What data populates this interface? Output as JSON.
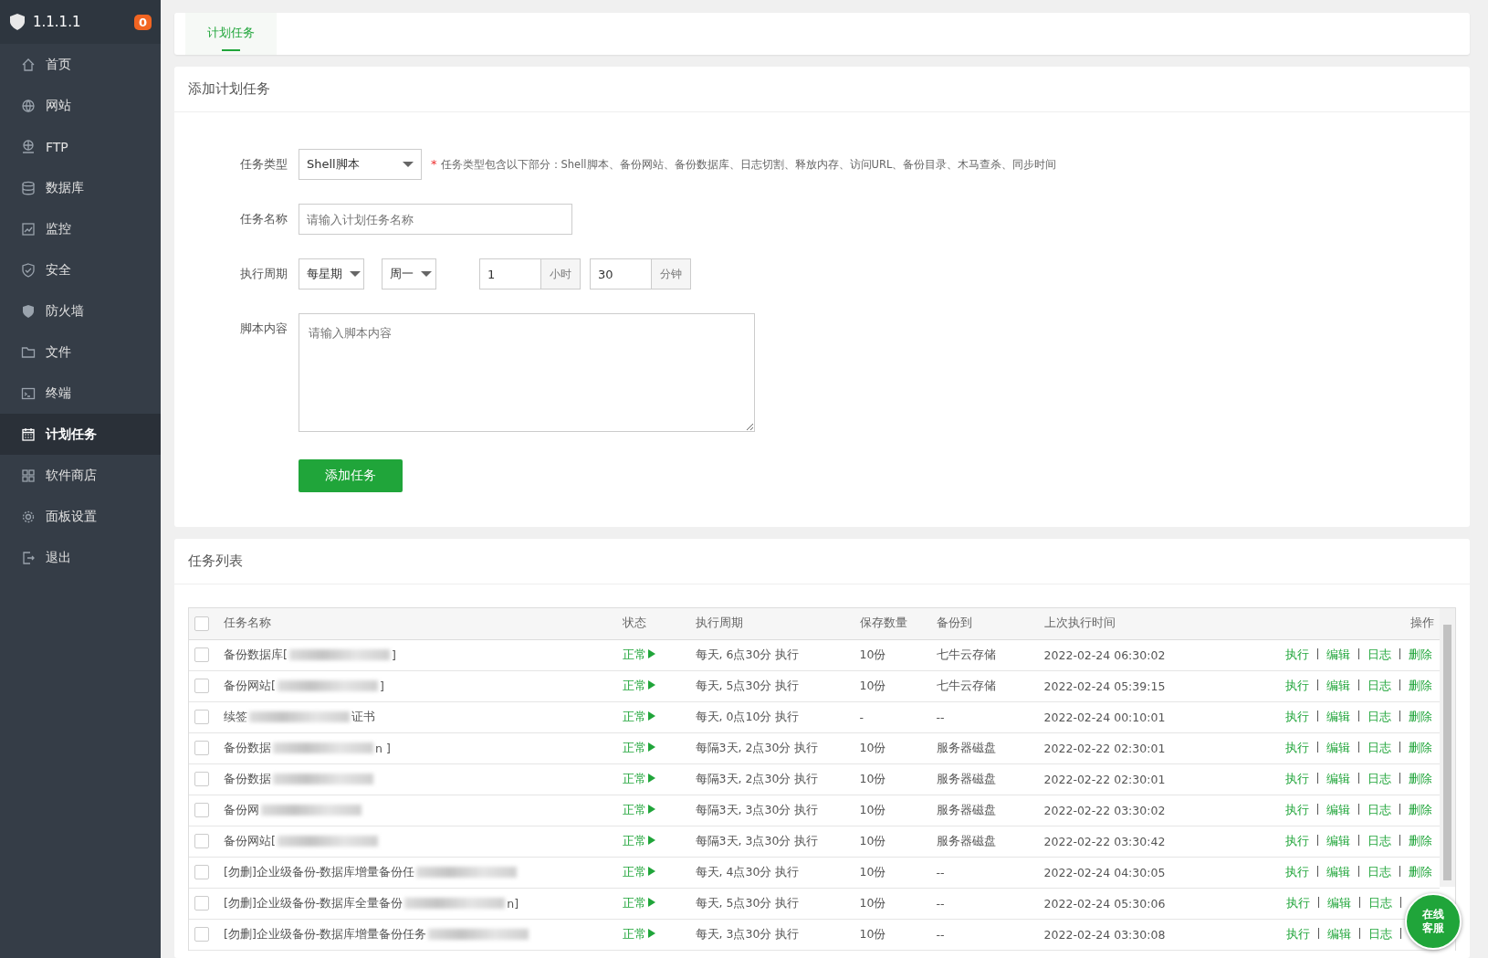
{
  "sidebar": {
    "brand": "1.1.1.1",
    "badge": "0",
    "items": [
      {
        "label": "首页",
        "selected": false
      },
      {
        "label": "网站",
        "selected": false
      },
      {
        "label": "FTP",
        "selected": false
      },
      {
        "label": "数据库",
        "selected": false
      },
      {
        "label": "监控",
        "selected": false
      },
      {
        "label": "安全",
        "selected": false
      },
      {
        "label": "防火墙",
        "selected": false
      },
      {
        "label": "文件",
        "selected": false
      },
      {
        "label": "终端",
        "selected": false
      },
      {
        "label": "计划任务",
        "selected": true
      },
      {
        "label": "软件商店",
        "selected": false
      },
      {
        "label": "面板设置",
        "selected": false
      },
      {
        "label": "退出",
        "selected": false
      }
    ]
  },
  "tabs": [
    {
      "label": "计划任务",
      "selected": true
    }
  ],
  "add_form": {
    "title": "添加计划任务",
    "type_label": "任务类型",
    "type_value": "Shell脚本",
    "required_mark": "*",
    "type_hint": "任务类型包含以下部分：Shell脚本、备份网站、备份数据库、日志切割、释放内存、访问URL、备份目录、木马查杀、同步时间",
    "name_label": "任务名称",
    "name_placeholder": "请输入计划任务名称",
    "cycle_label": "执行周期",
    "cycle_value": "每星期",
    "weekday_value": "周一",
    "hour_value": "1",
    "hour_unit": "小时",
    "minute_value": "30",
    "minute_unit": "分钟",
    "script_label": "脚本内容",
    "script_placeholder": "请输入脚本内容",
    "submit": "添加任务"
  },
  "task_list": {
    "title": "任务列表",
    "select_all_checked": false,
    "columns": [
      "任务名称",
      "状态",
      "执行周期",
      "保存数量",
      "备份到",
      "上次执行时间",
      "操作"
    ],
    "rows": [
      {
        "checked": false,
        "name": [
          "备份数据库[",
          "]"
        ],
        "redacted": true,
        "status": "正常",
        "cycle": "每天, 6点30分 执行",
        "keep": "10份",
        "backup_to": "七牛云存储",
        "last_run": "2022-02-24 06:30:02",
        "actions": [
          "执行",
          "编辑",
          "日志",
          "删除"
        ]
      },
      {
        "checked": false,
        "name": [
          "备份网站[",
          "]"
        ],
        "redacted": true,
        "status": "正常",
        "cycle": "每天, 5点30分 执行",
        "keep": "10份",
        "backup_to": "七牛云存储",
        "last_run": "2022-02-24 05:39:15",
        "actions": [
          "执行",
          "编辑",
          "日志",
          "删除"
        ]
      },
      {
        "checked": false,
        "name": [
          "续签",
          "证书"
        ],
        "redacted": true,
        "status": "正常",
        "cycle": "每天, 0点10分 执行",
        "keep": "-",
        "backup_to": "--",
        "last_run": "2022-02-24 00:10:01",
        "actions": [
          "执行",
          "编辑",
          "日志",
          "删除"
        ]
      },
      {
        "checked": false,
        "name": [
          "备份数据",
          "n ]"
        ],
        "redacted": true,
        "status": "正常",
        "cycle": "每隔3天, 2点30分 执行",
        "keep": "10份",
        "backup_to": "服务器磁盘",
        "last_run": "2022-02-22 02:30:01",
        "actions": [
          "执行",
          "编辑",
          "日志",
          "删除"
        ]
      },
      {
        "checked": false,
        "name": [
          "备份数据"
        ],
        "redacted": true,
        "status": "正常",
        "cycle": "每隔3天, 2点30分 执行",
        "keep": "10份",
        "backup_to": "服务器磁盘",
        "last_run": "2022-02-22 02:30:01",
        "actions": [
          "执行",
          "编辑",
          "日志",
          "删除"
        ]
      },
      {
        "checked": false,
        "name": [
          "备份网"
        ],
        "redacted": true,
        "status": "正常",
        "cycle": "每隔3天, 3点30分 执行",
        "keep": "10份",
        "backup_to": "服务器磁盘",
        "last_run": "2022-02-22 03:30:02",
        "actions": [
          "执行",
          "编辑",
          "日志",
          "删除"
        ]
      },
      {
        "checked": false,
        "name": [
          "备份网站["
        ],
        "redacted": true,
        "status": "正常",
        "cycle": "每隔3天, 3点30分 执行",
        "keep": "10份",
        "backup_to": "服务器磁盘",
        "last_run": "2022-02-22 03:30:42",
        "actions": [
          "执行",
          "编辑",
          "日志",
          "删除"
        ]
      },
      {
        "checked": false,
        "name": [
          "[勿删]企业级备份-数据库增量备份任"
        ],
        "redacted": true,
        "status": "正常",
        "cycle": "每天, 4点30分 执行",
        "keep": "10份",
        "backup_to": "--",
        "last_run": "2022-02-24 04:30:05",
        "actions": [
          "执行",
          "编辑",
          "日志",
          "删除"
        ]
      },
      {
        "checked": false,
        "name": [
          "[勿删]企业级备份-数据库全量备份",
          "n]"
        ],
        "redacted": true,
        "status": "正常",
        "cycle": "每天, 5点30分 执行",
        "keep": "10份",
        "backup_to": "--",
        "last_run": "2022-02-24 05:30:06",
        "actions": [
          "执行",
          "编辑",
          "日志"
        ]
      },
      {
        "checked": false,
        "name": [
          "[勿删]企业级备份-数据库增量备份任务"
        ],
        "redacted": true,
        "status": "正常",
        "cycle": "每天, 3点30分 执行",
        "keep": "10份",
        "backup_to": "--",
        "last_run": "2022-02-24 03:30:08",
        "actions": [
          "执行",
          "编辑",
          "日志"
        ]
      }
    ]
  },
  "chat_button": {
    "label": "在线客服"
  }
}
